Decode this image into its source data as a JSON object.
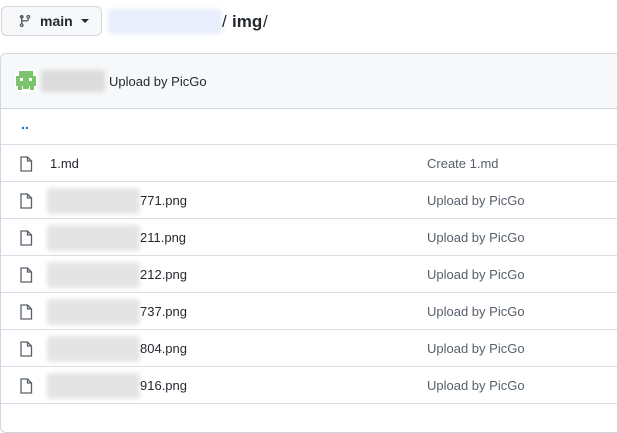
{
  "branch": {
    "label": "main",
    "icon": "git-branch-icon"
  },
  "breadcrumb": {
    "separator": "/",
    "current": "img"
  },
  "commit_header": {
    "message": "Upload by PicGo",
    "avatar_color": "#7cc36e"
  },
  "up_row": {
    "label": ".."
  },
  "files": [
    {
      "name": "1.md",
      "commit": "Create 1.md",
      "redacted": false
    },
    {
      "name": "771.png",
      "commit": "Upload by PicGo",
      "redacted": true
    },
    {
      "name": "211.png",
      "commit": "Upload by PicGo",
      "redacted": true
    },
    {
      "name": "212.png",
      "commit": "Upload by PicGo",
      "redacted": true
    },
    {
      "name": "737.png",
      "commit": "Upload by PicGo",
      "redacted": true
    },
    {
      "name": "804.png",
      "commit": "Upload by PicGo",
      "redacted": true
    },
    {
      "name": "916.png",
      "commit": "Upload by PicGo",
      "redacted": true
    }
  ],
  "colors": {
    "link": "#0969da",
    "text": "#24292f",
    "muted": "#57606a",
    "border": "#d0d7de"
  }
}
